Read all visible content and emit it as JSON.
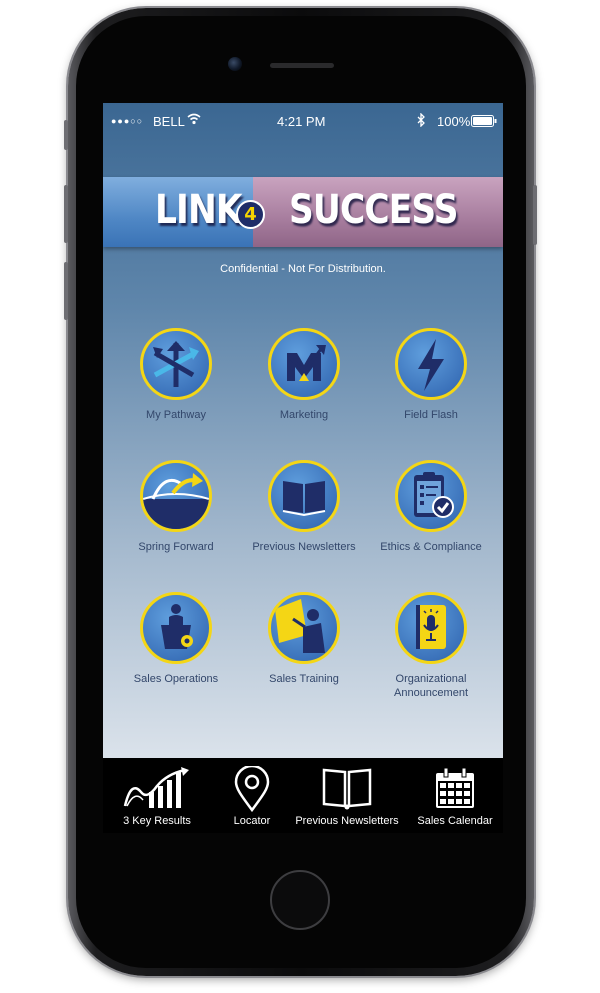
{
  "status_bar": {
    "carrier": "BELL",
    "time": "4:21 PM",
    "battery": "100%"
  },
  "banner": {
    "word_left": "LINK",
    "badge": "4",
    "word_right": "SUCCESS"
  },
  "notice": "Confidential - Not For Distribution.",
  "tiles": [
    {
      "label": "My Pathway",
      "icon": "pathway-arrows-icon"
    },
    {
      "label": "Marketing",
      "icon": "marketing-m-icon"
    },
    {
      "label": "Field Flash",
      "icon": "lightning-bolt-icon"
    },
    {
      "label": "Spring Forward",
      "icon": "spring-forward-icon"
    },
    {
      "label": "Previous Newsletters",
      "icon": "open-book-icon"
    },
    {
      "label": "Ethics & Compliance",
      "icon": "clipboard-check-icon"
    },
    {
      "label": "Sales Operations",
      "icon": "podium-gear-icon"
    },
    {
      "label": "Sales Training",
      "icon": "presenter-board-icon"
    },
    {
      "label": "Organizational Announcement",
      "icon": "microphone-icon"
    }
  ],
  "tabbar": [
    {
      "label": "3 Key Results",
      "icon": "growth-chart-icon"
    },
    {
      "label": "Locator",
      "icon": "location-pin-icon"
    },
    {
      "label": "Previous Newsletters",
      "icon": "book-icon"
    },
    {
      "label": "Sales Calendar",
      "icon": "calendar-icon"
    }
  ],
  "colors": {
    "accent_yellow": "#f4d615",
    "tile_blue": "#3c73bb",
    "navy": "#1f2d68",
    "tabbar": "#000000"
  }
}
